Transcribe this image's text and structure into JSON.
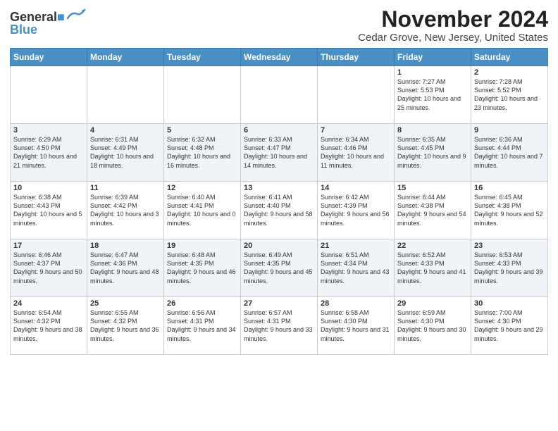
{
  "header": {
    "logo_line1": "General",
    "logo_line2": "Blue",
    "title": "November 2024",
    "subtitle": "Cedar Grove, New Jersey, United States"
  },
  "days_of_week": [
    "Sunday",
    "Monday",
    "Tuesday",
    "Wednesday",
    "Thursday",
    "Friday",
    "Saturday"
  ],
  "weeks": [
    [
      {
        "day": "",
        "info": ""
      },
      {
        "day": "",
        "info": ""
      },
      {
        "day": "",
        "info": ""
      },
      {
        "day": "",
        "info": ""
      },
      {
        "day": "",
        "info": ""
      },
      {
        "day": "1",
        "info": "Sunrise: 7:27 AM\nSunset: 5:53 PM\nDaylight: 10 hours and 25 minutes."
      },
      {
        "day": "2",
        "info": "Sunrise: 7:28 AM\nSunset: 5:52 PM\nDaylight: 10 hours and 23 minutes."
      }
    ],
    [
      {
        "day": "3",
        "info": "Sunrise: 6:29 AM\nSunset: 4:50 PM\nDaylight: 10 hours and 21 minutes."
      },
      {
        "day": "4",
        "info": "Sunrise: 6:31 AM\nSunset: 4:49 PM\nDaylight: 10 hours and 18 minutes."
      },
      {
        "day": "5",
        "info": "Sunrise: 6:32 AM\nSunset: 4:48 PM\nDaylight: 10 hours and 16 minutes."
      },
      {
        "day": "6",
        "info": "Sunrise: 6:33 AM\nSunset: 4:47 PM\nDaylight: 10 hours and 14 minutes."
      },
      {
        "day": "7",
        "info": "Sunrise: 6:34 AM\nSunset: 4:46 PM\nDaylight: 10 hours and 11 minutes."
      },
      {
        "day": "8",
        "info": "Sunrise: 6:35 AM\nSunset: 4:45 PM\nDaylight: 10 hours and 9 minutes."
      },
      {
        "day": "9",
        "info": "Sunrise: 6:36 AM\nSunset: 4:44 PM\nDaylight: 10 hours and 7 minutes."
      }
    ],
    [
      {
        "day": "10",
        "info": "Sunrise: 6:38 AM\nSunset: 4:43 PM\nDaylight: 10 hours and 5 minutes."
      },
      {
        "day": "11",
        "info": "Sunrise: 6:39 AM\nSunset: 4:42 PM\nDaylight: 10 hours and 3 minutes."
      },
      {
        "day": "12",
        "info": "Sunrise: 6:40 AM\nSunset: 4:41 PM\nDaylight: 10 hours and 0 minutes."
      },
      {
        "day": "13",
        "info": "Sunrise: 6:41 AM\nSunset: 4:40 PM\nDaylight: 9 hours and 58 minutes."
      },
      {
        "day": "14",
        "info": "Sunrise: 6:42 AM\nSunset: 4:39 PM\nDaylight: 9 hours and 56 minutes."
      },
      {
        "day": "15",
        "info": "Sunrise: 6:44 AM\nSunset: 4:38 PM\nDaylight: 9 hours and 54 minutes."
      },
      {
        "day": "16",
        "info": "Sunrise: 6:45 AM\nSunset: 4:38 PM\nDaylight: 9 hours and 52 minutes."
      }
    ],
    [
      {
        "day": "17",
        "info": "Sunrise: 6:46 AM\nSunset: 4:37 PM\nDaylight: 9 hours and 50 minutes."
      },
      {
        "day": "18",
        "info": "Sunrise: 6:47 AM\nSunset: 4:36 PM\nDaylight: 9 hours and 48 minutes."
      },
      {
        "day": "19",
        "info": "Sunrise: 6:48 AM\nSunset: 4:35 PM\nDaylight: 9 hours and 46 minutes."
      },
      {
        "day": "20",
        "info": "Sunrise: 6:49 AM\nSunset: 4:35 PM\nDaylight: 9 hours and 45 minutes."
      },
      {
        "day": "21",
        "info": "Sunrise: 6:51 AM\nSunset: 4:34 PM\nDaylight: 9 hours and 43 minutes."
      },
      {
        "day": "22",
        "info": "Sunrise: 6:52 AM\nSunset: 4:33 PM\nDaylight: 9 hours and 41 minutes."
      },
      {
        "day": "23",
        "info": "Sunrise: 6:53 AM\nSunset: 4:33 PM\nDaylight: 9 hours and 39 minutes."
      }
    ],
    [
      {
        "day": "24",
        "info": "Sunrise: 6:54 AM\nSunset: 4:32 PM\nDaylight: 9 hours and 38 minutes."
      },
      {
        "day": "25",
        "info": "Sunrise: 6:55 AM\nSunset: 4:32 PM\nDaylight: 9 hours and 36 minutes."
      },
      {
        "day": "26",
        "info": "Sunrise: 6:56 AM\nSunset: 4:31 PM\nDaylight: 9 hours and 34 minutes."
      },
      {
        "day": "27",
        "info": "Sunrise: 6:57 AM\nSunset: 4:31 PM\nDaylight: 9 hours and 33 minutes."
      },
      {
        "day": "28",
        "info": "Sunrise: 6:58 AM\nSunset: 4:30 PM\nDaylight: 9 hours and 31 minutes."
      },
      {
        "day": "29",
        "info": "Sunrise: 6:59 AM\nSunset: 4:30 PM\nDaylight: 9 hours and 30 minutes."
      },
      {
        "day": "30",
        "info": "Sunrise: 7:00 AM\nSunset: 4:30 PM\nDaylight: 9 hours and 29 minutes."
      }
    ]
  ]
}
